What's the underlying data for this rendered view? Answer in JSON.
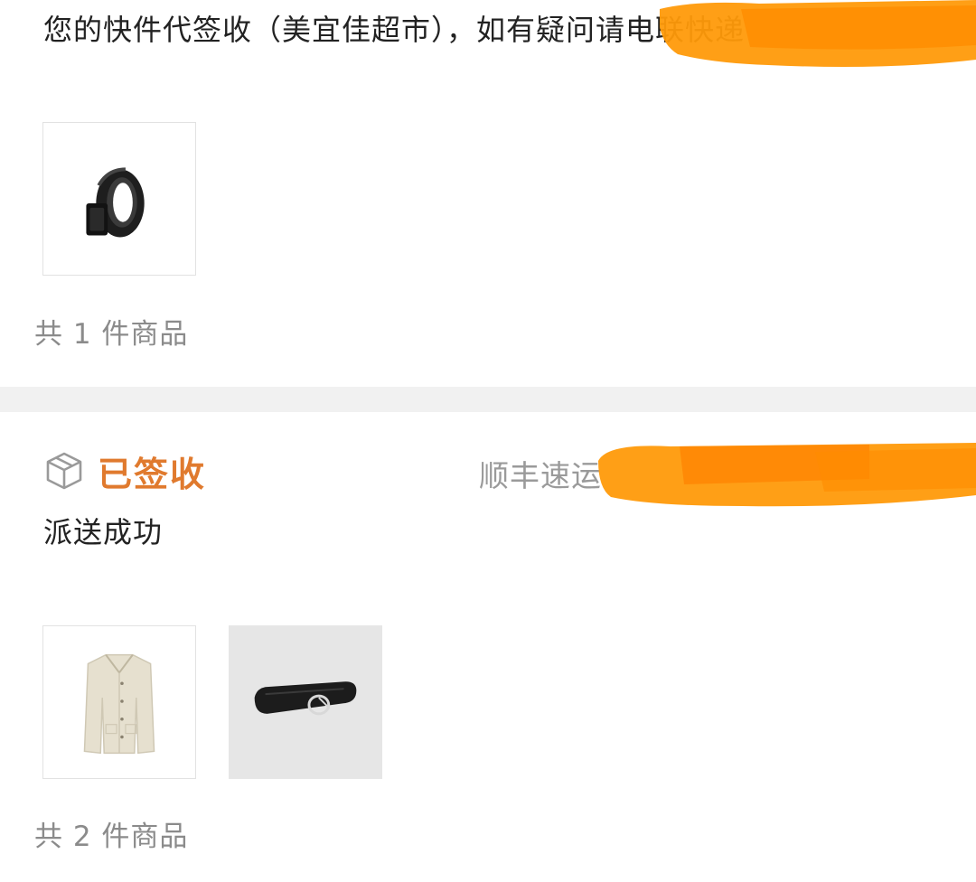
{
  "colors": {
    "accent": "#e07a2e",
    "redaction": "#ff9a0a",
    "muted_text": "#8b8b8b",
    "divider": "#f1f1f1"
  },
  "order_1": {
    "notice": "您的快件代签收（美宜佳超市），如有疑问请电联快递",
    "items": [
      {
        "image": "black-belt-roll"
      }
    ],
    "count_label": "共 1 件商品"
  },
  "order_2": {
    "status_icon": "package-box-icon",
    "status": "已签收",
    "courier": "顺丰速运",
    "detail": "派送成功",
    "items": [
      {
        "image": "cream-knit-jacket"
      },
      {
        "image": "black-leather-belt"
      }
    ],
    "count_label": "共 2 件商品"
  }
}
